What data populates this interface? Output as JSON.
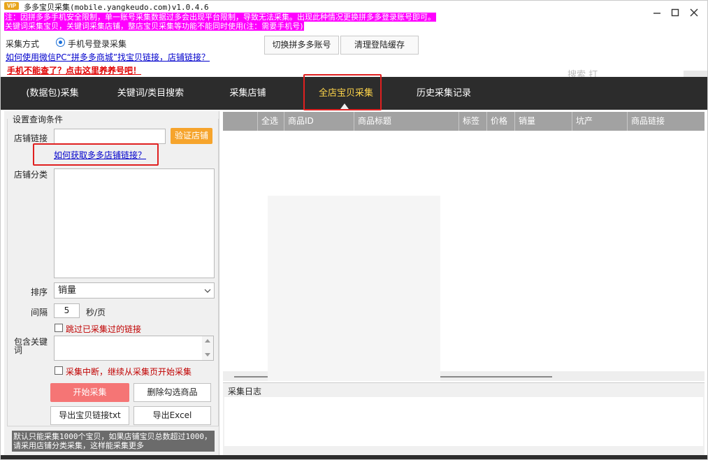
{
  "window": {
    "title": "多多宝贝采集(mobile.yangkeudo.com)v1.0.4.6",
    "badge": "VIP",
    "controls": [
      "minimize-icon",
      "maximize-icon",
      "close-icon"
    ]
  },
  "notices": [
    "注：因拼多多手机安全限制，单一账号采集数据过多会出现平台限制，导致无法采集。出现此种情况更换拼多多登录账号即可。",
    "关键词采集宝贝，关键词采集店铺，整店宝贝采集等功能不能同时使用(注：需要手机号)"
  ],
  "top": {
    "mode_label": "采集方式",
    "mode_option": "手机号登录采集",
    "wechat_link": "如何使用微信PC“拼多多商城”找宝贝链接，店铺链接？",
    "phone_link": "手机不能查了？点击这里养养号吧！",
    "switch_account_button": "切换拼多多账号",
    "clear_cache_button": "清理登陆缓存",
    "bg_search_hint": "搜索 打"
  },
  "nav": {
    "tabs": [
      {
        "label": "(数据包)采集"
      },
      {
        "label": "关键词/类目搜索"
      },
      {
        "label": "采集店铺"
      },
      {
        "label": "全店宝贝采集"
      },
      {
        "label": "历史采集记录"
      }
    ],
    "active_index": 3
  },
  "form": {
    "group_title": "设置查询条件",
    "shop_link_label": "店铺链接",
    "shop_link_value": "",
    "verify_button": "验证店铺",
    "how_get_link": "如何获取多多店铺链接？",
    "shop_category_label": "店铺分类",
    "sort_label": "排序",
    "sort_value": "销量",
    "interval_label": "间隔",
    "interval_value": "5",
    "interval_unit": "秒/页",
    "skip_collected_label": "跳过已采集过的链接",
    "keywords_label_1": "包含关键",
    "keywords_label_2": "词",
    "resume_label": "采集中断，继续从采集页开始采集",
    "start_button": "开始采集",
    "delete_button": "删除勾选商品",
    "export_txt_button": "导出宝贝链接txt",
    "export_excel_button": "导出Excel",
    "footnote": "默认只能采集1000个宝贝，如果店铺宝贝总数超过1000，请采用店铺分类采集，这样能采集更多"
  },
  "grid": {
    "columns": [
      "",
      "全选",
      "商品ID",
      "商品标题",
      "标签",
      "价格",
      "销量",
      "坑产",
      "商品链接"
    ]
  },
  "log": {
    "title": "采集日志"
  },
  "colors": {
    "nav_bg": "#2c2c2c",
    "active_tab": "#ffd54a",
    "notice_bg": "#ff00ff",
    "verify_btn": "#f6a42c",
    "start_btn": "#f57575",
    "annotation": "#e02020"
  }
}
